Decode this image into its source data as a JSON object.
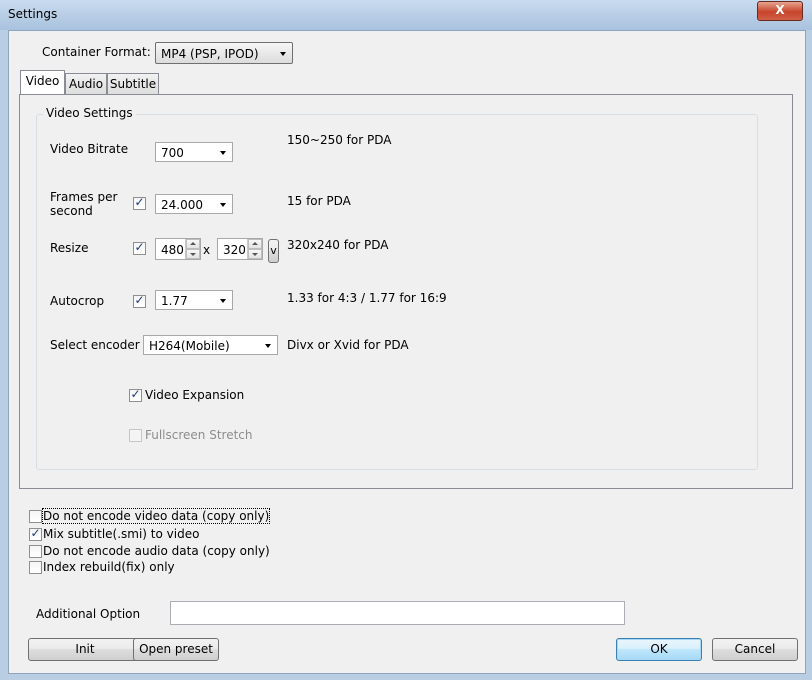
{
  "window": {
    "title": "Settings",
    "close_label": "X"
  },
  "container_format": {
    "label": "Container Format:",
    "value": "MP4 (PSP, IPOD)"
  },
  "tabs": [
    {
      "label": "Video"
    },
    {
      "label": "Audio"
    },
    {
      "label": "Subtitle"
    }
  ],
  "video_settings": {
    "group_title": "Video Settings",
    "bitrate": {
      "label": "Video Bitrate",
      "value": "700",
      "hint": "150~250 for PDA"
    },
    "fps": {
      "label_line1": "Frames per",
      "label_line2": "second",
      "checked": true,
      "value": "24.000",
      "hint": "15 for PDA"
    },
    "resize": {
      "label": "Resize",
      "checked": true,
      "width": "480",
      "sep": "x",
      "height": "320",
      "btn": "v",
      "hint": "320x240 for PDA"
    },
    "autocrop": {
      "label": "Autocrop",
      "checked": true,
      "value": "1.77",
      "hint": "1.33 for 4:3 / 1.77 for 16:9"
    },
    "encoder": {
      "label": "Select encoder",
      "value": "H264(Mobile)",
      "hint": "Divx or Xvid for PDA"
    },
    "expansion": {
      "label": "Video Expansion",
      "checked": true
    },
    "fullscreen": {
      "label": "Fullscreen Stretch",
      "checked": false,
      "disabled": true
    }
  },
  "options": [
    {
      "label": "Do not encode video data (copy only)",
      "checked": false
    },
    {
      "label": "Mix subtitle(.smi) to video",
      "checked": true
    },
    {
      "label": "Do not encode audio data (copy only)",
      "checked": false
    },
    {
      "label": "Index rebuild(fix) only",
      "checked": false
    }
  ],
  "additional_option": {
    "label": "Additional Option",
    "value": ""
  },
  "buttons": {
    "init": "Init",
    "open_preset": "Open preset",
    "ok": "OK",
    "cancel": "Cancel"
  },
  "check_mark": "✓"
}
